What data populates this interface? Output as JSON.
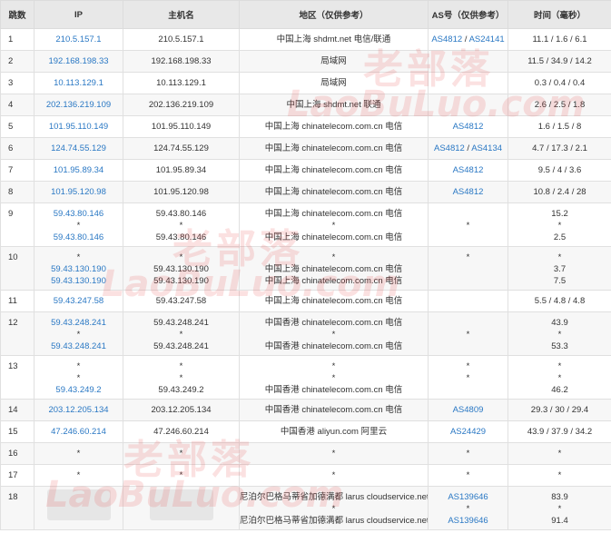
{
  "headers": [
    "跳数",
    "IP",
    "主机名",
    "地区（仅供参考）",
    "AS号（仅供参考）",
    "时间（毫秒）"
  ],
  "rows": [
    {
      "hop": "1",
      "ip": [
        "210.5.157.1"
      ],
      "host": [
        "210.5.157.1"
      ],
      "region": [
        "中国上海 shdmt.net 电信/联通"
      ],
      "as": [
        [
          "AS4812",
          "AS24141"
        ]
      ],
      "time": [
        "11.1 / 1.6 / 6.1"
      ]
    },
    {
      "hop": "2",
      "ip": [
        "192.168.198.33"
      ],
      "host": [
        "192.168.198.33"
      ],
      "region": [
        "局域网"
      ],
      "as": [
        []
      ],
      "time": [
        "11.5 / 34.9 / 14.2"
      ]
    },
    {
      "hop": "3",
      "ip": [
        "10.113.129.1"
      ],
      "host": [
        "10.113.129.1"
      ],
      "region": [
        "局域网"
      ],
      "as": [
        []
      ],
      "time": [
        "0.3 / 0.4 / 0.4"
      ]
    },
    {
      "hop": "4",
      "ip": [
        "202.136.219.109"
      ],
      "host": [
        "202.136.219.109"
      ],
      "region": [
        "中国上海 shdmt.net 联通"
      ],
      "as": [
        []
      ],
      "time": [
        "2.6 / 2.5 / 1.8"
      ]
    },
    {
      "hop": "5",
      "ip": [
        "101.95.110.149"
      ],
      "host": [
        "101.95.110.149"
      ],
      "region": [
        "中国上海 chinatelecom.com.cn 电信"
      ],
      "as": [
        [
          "AS4812"
        ]
      ],
      "time": [
        "1.6 / 1.5 / 8"
      ]
    },
    {
      "hop": "6",
      "ip": [
        "124.74.55.129"
      ],
      "host": [
        "124.74.55.129"
      ],
      "region": [
        "中国上海 chinatelecom.com.cn 电信"
      ],
      "as": [
        [
          "AS4812",
          "AS4134"
        ]
      ],
      "time": [
        "4.7 / 17.3 / 2.1"
      ]
    },
    {
      "hop": "7",
      "ip": [
        "101.95.89.34"
      ],
      "host": [
        "101.95.89.34"
      ],
      "region": [
        "中国上海 chinatelecom.com.cn 电信"
      ],
      "as": [
        [
          "AS4812"
        ]
      ],
      "time": [
        "9.5 / 4 / 3.6"
      ]
    },
    {
      "hop": "8",
      "ip": [
        "101.95.120.98"
      ],
      "host": [
        "101.95.120.98"
      ],
      "region": [
        "中国上海 chinatelecom.com.cn 电信"
      ],
      "as": [
        [
          "AS4812"
        ]
      ],
      "time": [
        "10.8 / 2.4 / 28"
      ]
    },
    {
      "hop": "9",
      "ip": [
        "59.43.80.146",
        "*",
        "59.43.80.146"
      ],
      "host": [
        "59.43.80.146",
        "*",
        "59.43.80.146"
      ],
      "region": [
        "中国上海 chinatelecom.com.cn 电信",
        "*",
        "中国上海 chinatelecom.com.cn 电信"
      ],
      "as": [
        [],
        [
          "*"
        ],
        []
      ],
      "time": [
        "15.2",
        "*",
        "2.5"
      ]
    },
    {
      "hop": "10",
      "ip": [
        "*",
        "59.43.130.190",
        "59.43.130.190"
      ],
      "host": [
        "*",
        "59.43.130.190",
        "59.43.130.190"
      ],
      "region": [
        "*",
        "中国上海 chinatelecom.com.cn 电信",
        "中国上海 chinatelecom.com.cn 电信"
      ],
      "as": [
        [
          "*"
        ],
        [],
        []
      ],
      "time": [
        "*",
        "3.7",
        "7.5"
      ]
    },
    {
      "hop": "11",
      "ip": [
        "59.43.247.58"
      ],
      "host": [
        "59.43.247.58"
      ],
      "region": [
        "中国上海 chinatelecom.com.cn 电信"
      ],
      "as": [
        []
      ],
      "time": [
        "5.5 / 4.8 / 4.8"
      ]
    },
    {
      "hop": "12",
      "ip": [
        "59.43.248.241",
        "*",
        "59.43.248.241"
      ],
      "host": [
        "59.43.248.241",
        "*",
        "59.43.248.241"
      ],
      "region": [
        "中国香港 chinatelecom.com.cn 电信",
        "*",
        "中国香港 chinatelecom.com.cn 电信"
      ],
      "as": [
        [],
        [
          "*"
        ],
        []
      ],
      "time": [
        "43.9",
        "*",
        "53.3"
      ]
    },
    {
      "hop": "13",
      "ip": [
        "*",
        "*",
        "59.43.249.2"
      ],
      "host": [
        "*",
        "*",
        "59.43.249.2"
      ],
      "region": [
        "*",
        "*",
        "中国香港 chinatelecom.com.cn 电信"
      ],
      "as": [
        [
          "*"
        ],
        [
          "*"
        ],
        []
      ],
      "time": [
        "*",
        "*",
        "46.2"
      ]
    },
    {
      "hop": "14",
      "ip": [
        "203.12.205.134"
      ],
      "host": [
        "203.12.205.134"
      ],
      "region": [
        "中国香港 chinatelecom.com.cn 电信"
      ],
      "as": [
        [
          "AS4809"
        ]
      ],
      "time": [
        "29.3 / 30 / 29.4"
      ]
    },
    {
      "hop": "15",
      "ip": [
        "47.246.60.214"
      ],
      "host": [
        "47.246.60.214"
      ],
      "region": [
        "中国香港 aliyun.com 阿里云"
      ],
      "as": [
        [
          "AS24429"
        ]
      ],
      "time": [
        "43.9 / 37.9 / 34.2"
      ]
    },
    {
      "hop": "16",
      "ip": [
        "*"
      ],
      "host": [
        "*"
      ],
      "region": [
        "*"
      ],
      "as": [
        [
          "*"
        ]
      ],
      "time": [
        "*"
      ]
    },
    {
      "hop": "17",
      "ip": [
        "*"
      ],
      "host": [
        "*"
      ],
      "region": [
        "*"
      ],
      "as": [
        [
          "*"
        ]
      ],
      "time": [
        "*"
      ]
    },
    {
      "hop": "18",
      "ip": [],
      "host": [],
      "region": [
        "尼泊尔巴格马蒂省加德满都 larus cloudservice.net",
        "*",
        "尼泊尔巴格马蒂省加德满都 larus cloudservice.net"
      ],
      "as": [
        [
          "AS139646"
        ],
        [
          "*"
        ],
        [
          "AS139646"
        ]
      ],
      "time": [
        "83.9",
        "*",
        "91.4"
      ],
      "redacted": true
    }
  ],
  "watermark": {
    "cn": "老部落",
    "en": "LaoBuLuo.com"
  }
}
